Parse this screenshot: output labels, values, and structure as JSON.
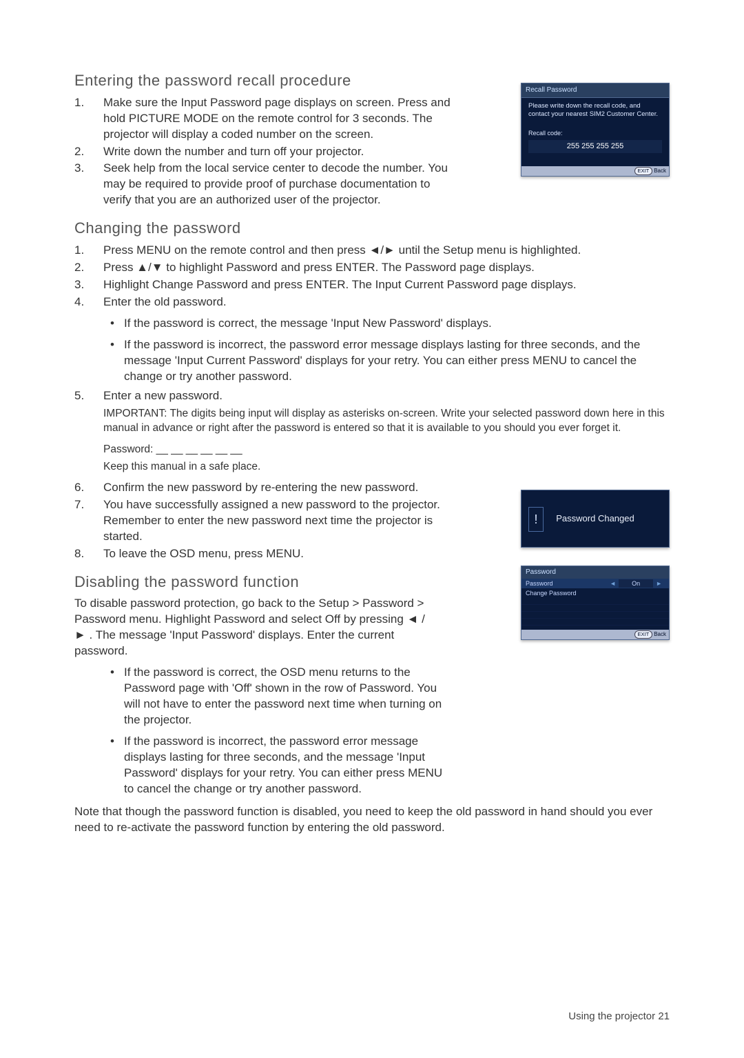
{
  "section1": {
    "heading": "Entering the password recall procedure",
    "steps": [
      {
        "num": "1.",
        "text": "Make sure the Input Password page displays on screen. Press and hold PICTURE MODE on the remote control for 3 seconds. The projector will display a coded number on the screen."
      },
      {
        "num": "2.",
        "text": "Write down the number and turn off your projector."
      },
      {
        "num": "3.",
        "text": "Seek help from the local service center to decode the number. You may be required to provide proof of purchase documentation to verify that you are an authorized user of the projector."
      }
    ]
  },
  "osd1": {
    "title": "Recall Password",
    "body": "Please write down the recall code, and contact your nearest SIM2 Customer Center.",
    "recall_label": "Recall code:",
    "recall_code": "255 255 255 255",
    "exit_btn": "EXIT",
    "back_label": "Back"
  },
  "section2": {
    "heading": "Changing the password",
    "steps": [
      {
        "num": "1.",
        "text": "Press MENU on the remote control and then press ◄/► until the Setup menu is highlighted."
      },
      {
        "num": "2.",
        "text": "Press ▲/▼ to highlight Password and press ENTER. The Password page displays."
      },
      {
        "num": "3.",
        "text": "Highlight Change Password and press ENTER. The Input Current Password page displays."
      },
      {
        "num": "4.",
        "text": "Enter the old password."
      }
    ],
    "sub4": [
      "If the password is correct, the message 'Input New Password' displays.",
      "If the password is incorrect, the password error message displays lasting for three seconds, and the message 'Input Current Password' displays for your retry. You can either press MENU to cancel the change or try another password."
    ],
    "step5": {
      "num": "5.",
      "text": "Enter a new password."
    },
    "important": "IMPORTANT: The digits being input will display as asterisks on-screen. Write your selected password down here in this manual in advance or right after the password is entered so that it is available to you should you ever forget it.",
    "pwd_line": "Password: __ __ __ __ __ __",
    "keep": "Keep this manual in a safe place.",
    "steps6": [
      {
        "num": "6.",
        "text": "Confirm the new password by re-entering the new password."
      },
      {
        "num": "7.",
        "text": "You have successfully assigned a new password to the projector. Remember to enter the new password next time the projector is started."
      },
      {
        "num": "8.",
        "text": "To leave the OSD menu, press MENU."
      }
    ]
  },
  "osd2": {
    "msg": "Password Changed"
  },
  "section3": {
    "heading": "Disabling the password function",
    "intro": "To disable password protection, go back to the Setup > Password > Password menu. Highlight Password and select Off by pressing ◄ / ► . The message 'Input Password' displays. Enter the current password.",
    "bullets": [
      "If the password is correct, the OSD menu returns to the Password page with 'Off' shown in the row of Password. You will not have to enter the password next time when turning on the projector.",
      "If the password is incorrect, the password error message displays lasting for three seconds, and the message 'Input Password' displays for your retry. You can either press MENU to cancel the change or try another password."
    ],
    "note": "Note that though the password function is disabled, you need to keep the old password in hand should you ever need to re-activate the password function by entering the old password."
  },
  "osd3": {
    "title": "Password",
    "row1_label": "Password",
    "row1_val": "On",
    "row2_label": "Change Password",
    "exit_btn": "EXIT",
    "back_label": "Back"
  },
  "footer": "Using the projector   21"
}
